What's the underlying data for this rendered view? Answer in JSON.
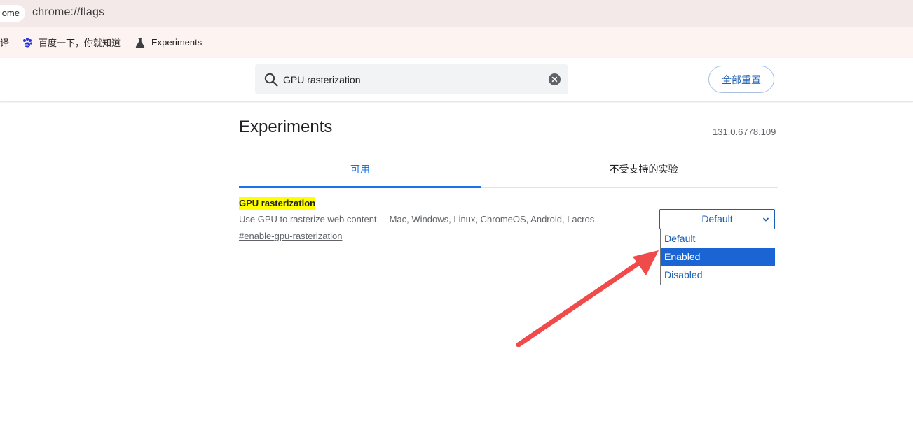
{
  "browser": {
    "tab_chip": "ome",
    "url": "chrome://flags"
  },
  "bookmarks": [
    {
      "label": "译",
      "icon": "truncated-bookmark"
    },
    {
      "label": "百度一下，你就知道",
      "icon": "baidu-paw-icon"
    },
    {
      "label": "Experiments",
      "icon": "flask-icon"
    }
  ],
  "header": {
    "search_value": "GPU rasterization",
    "reset_label": "全部重置"
  },
  "page": {
    "title": "Experiments",
    "version": "131.0.6778.109",
    "tabs": [
      {
        "label": "可用",
        "active": true
      },
      {
        "label": "不受支持的实验",
        "active": false
      }
    ]
  },
  "flag": {
    "name": "GPU rasterization",
    "description": "Use GPU to rasterize web content. – Mac, Windows, Linux, ChromeOS, Android, Lacros",
    "link": "#enable-gpu-rasterization",
    "selected_value": "Default",
    "options": [
      "Default",
      "Enabled",
      "Disabled"
    ],
    "highlighted_option": "Enabled"
  },
  "colors": {
    "accent": "#1a73e8",
    "highlight": "#ffff00",
    "annotation_arrow": "#f04a4a"
  }
}
